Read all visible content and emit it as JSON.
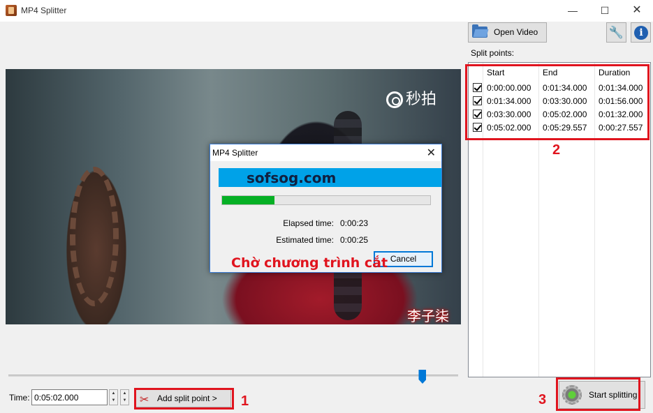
{
  "window": {
    "title": "MP4 Splitter",
    "controls": {
      "minimize": "—",
      "maximize": "☐",
      "close": "✕"
    }
  },
  "video": {
    "watermark": "秒拍",
    "caption": "李子柒",
    "icon": "camera-icon"
  },
  "toolbar": {
    "open_video_label": "Open Video",
    "tools_icon": "wrench-icon",
    "info_icon": "info-icon",
    "info_glyph": "i"
  },
  "split_points": {
    "label": "Split points:",
    "columns": [
      "Start",
      "End",
      "Duration"
    ],
    "rows": [
      {
        "checked": true,
        "start": "0:00:00.000",
        "end": "0:01:34.000",
        "duration": "0:01:34.000"
      },
      {
        "checked": true,
        "start": "0:01:34.000",
        "end": "0:03:30.000",
        "duration": "0:01:56.000"
      },
      {
        "checked": true,
        "start": "0:03:30.000",
        "end": "0:05:02.000",
        "duration": "0:01:32.000"
      },
      {
        "checked": true,
        "start": "0:05:02.000",
        "end": "0:05:29.557",
        "duration": "0:00:27.557"
      }
    ]
  },
  "dialog": {
    "title": "MP4 Splitter",
    "banner_text": "sofsog.com",
    "progress_fraction": 0.25,
    "elapsed_label": "Elapsed time:",
    "elapsed_value": "0:00:23",
    "estimated_label": "Estimated time:",
    "estimated_value": "0:00:25",
    "cancel_label": "Cancel",
    "wait_text": "Chờ chương trình cắt"
  },
  "controls": {
    "time_label": "Time:",
    "time_value": "0:05:02.000",
    "add_split_label": "Add split point >",
    "start_splitting_label": "Start splitting",
    "slider_fraction": 0.92
  },
  "annotations": {
    "num1": "1",
    "num2": "2",
    "num3": "3",
    "color": "#e0141e"
  }
}
